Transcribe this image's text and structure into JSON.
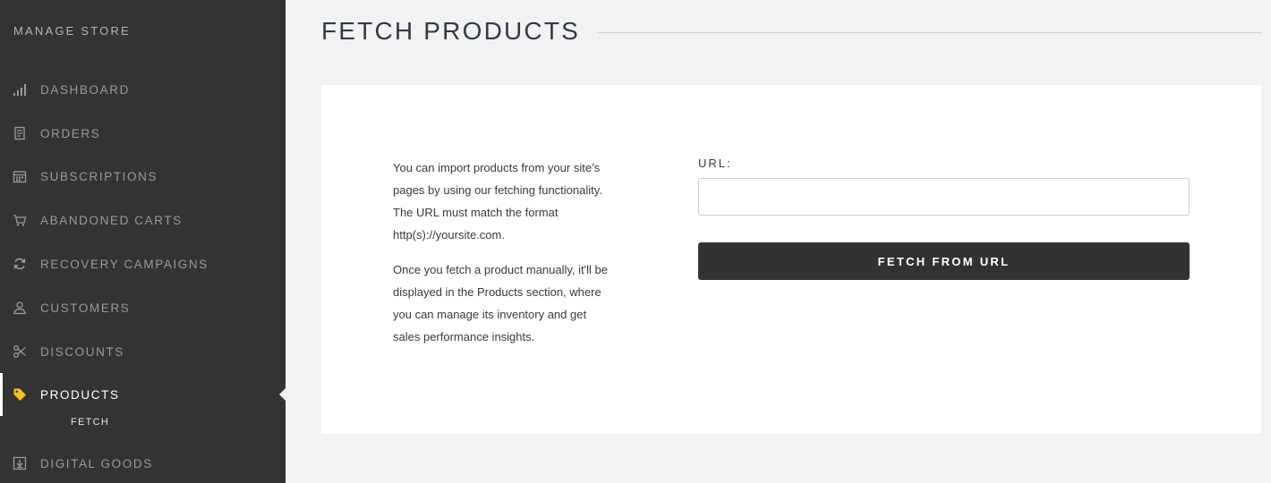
{
  "sidebar": {
    "title": "MANAGE STORE",
    "items": [
      {
        "label": "DASHBOARD",
        "icon": "bar-chart-icon"
      },
      {
        "label": "ORDERS",
        "icon": "receipt-icon"
      },
      {
        "label": "SUBSCRIPTIONS",
        "icon": "calendar-icon"
      },
      {
        "label": "ABANDONED CARTS",
        "icon": "cart-icon"
      },
      {
        "label": "RECOVERY CAMPAIGNS",
        "icon": "refresh-icon"
      },
      {
        "label": "CUSTOMERS",
        "icon": "user-icon"
      },
      {
        "label": "DISCOUNTS",
        "icon": "scissors-icon"
      },
      {
        "label": "PRODUCTS",
        "icon": "tag-icon",
        "active": true
      },
      {
        "label": "DIGITAL GOODS",
        "icon": "download-box-icon"
      }
    ],
    "sub_item": "FETCH"
  },
  "main": {
    "title": "FETCH PRODUCTS",
    "description": [
      "You can import products from your site’s pages by using our fetching functionality. The URL must match the format http(s)://yoursite.com.",
      "Once you fetch a product manually, it'll be displayed in the Products section, where you can manage its inventory and get sales performance insights."
    ],
    "url_label": "URL:",
    "url_value": "",
    "url_placeholder": "",
    "button_label": "FETCH FROM URL"
  },
  "colors": {
    "sidebar_bg": "#333333",
    "page_bg": "#f2f2f2",
    "active_icon": "#f5c518",
    "button_bg": "#323232"
  }
}
